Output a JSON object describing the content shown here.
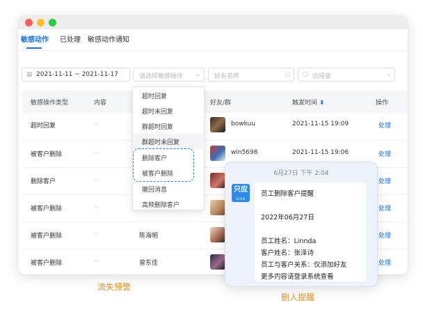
{
  "tabs": [
    "敏感动作",
    "已处理",
    "敏感动作通知"
  ],
  "filters": {
    "date_range": "2021-11-11 ~ 2021-11-17",
    "action_type_placeholder": "请选择敏感操作",
    "friend_placeholder": "好友名称",
    "employee_placeholder": "迈得豪"
  },
  "table": {
    "headers": [
      "敏感操作类型",
      "内容",
      "好友/群",
      "触发时间",
      "操作"
    ],
    "rows": [
      {
        "type": "超时回复",
        "content": "--",
        "friend": "bowkuu",
        "time": "2021-11-15 19:09",
        "action": "处理"
      },
      {
        "type": "被客户删除",
        "content": "--",
        "friend": "win5698",
        "time": "2021-11-15 19:06",
        "action": "处理"
      },
      {
        "type": "删除客户",
        "content": "--",
        "friend": "",
        "time": "",
        "action": "处理"
      },
      {
        "type": "被客户删除",
        "content": "--",
        "friend": "",
        "time": "",
        "action": "处理"
      },
      {
        "type": "被客户删除",
        "content": "--",
        "employee": "陈海明",
        "friend": "",
        "time": "",
        "action": "处理"
      },
      {
        "type": "被客户删除",
        "content": "--",
        "employee": "曾东佳",
        "friend": "",
        "time": "",
        "action": "处理"
      }
    ]
  },
  "dropdown_options": [
    "超时回复",
    "超时未回复",
    "群超时回复",
    "群超时未回复",
    "删除客户",
    "被客户删除",
    "撤回消息",
    "高频删除客户"
  ],
  "notification": {
    "timestamp": "6月27日 下午 2:04",
    "app_icon_text": "只应",
    "app_icon_sub": "SCRM",
    "lines": [
      "员工删除客户提醒",
      "2022年06月27日",
      "员工姓名：Linnda",
      "客户姓名：张泽诗",
      "员工与客户关系：仅添加好友",
      "更多内容请登录系统查看"
    ]
  },
  "captions": {
    "left": "流失预警",
    "right": "删人提醒"
  },
  "colors": {
    "accent": "#1a73e8",
    "caption": "#e58b1f",
    "app_icon": "#2e8af0"
  }
}
